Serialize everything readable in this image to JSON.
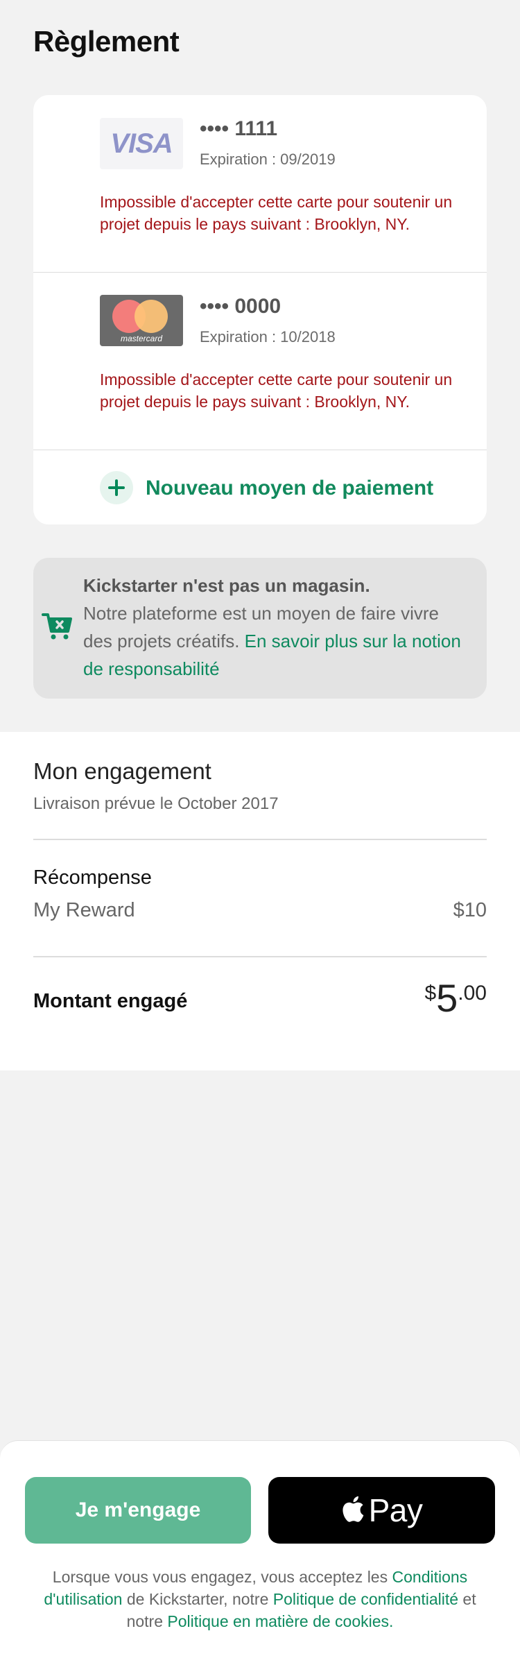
{
  "page": {
    "title": "Règlement"
  },
  "cards": [
    {
      "brand": "visa",
      "logo_text": "VISA",
      "masked_number": "•••• 1111",
      "expiry": "Expiration : 09/2019",
      "error": "Impossible d'accepter cette carte pour soutenir un projet depuis le pays suivant : Brooklyn, NY."
    },
    {
      "brand": "mastercard",
      "logo_text": "mastercard",
      "masked_number": "•••• 0000",
      "expiry": "Expiration : 10/2018",
      "error": "Impossible d'accepter cette carte pour soutenir un projet depuis le pays suivant : Brooklyn, NY."
    }
  ],
  "add_payment": {
    "label": "Nouveau moyen de paiement",
    "icon": "plus-icon"
  },
  "notice": {
    "icon": "cart-icon",
    "heading": "Kickstarter n'est pas un magasin.",
    "body": "Notre plateforme est un moyen de faire vivre des projets créatifs. ",
    "link": "En savoir plus sur la notion de responsabilité"
  },
  "pledge": {
    "title": "Mon engagement",
    "delivery": "Livraison prévue le October 2017",
    "reward_heading": "Récompense",
    "reward_name": "My Reward",
    "reward_price": "$10",
    "pledged_label": "Montant engagé",
    "amount_currency": "$",
    "amount_integer": "5",
    "amount_decimal": ".00"
  },
  "footer": {
    "pledge_button": "Je m'engage",
    "apple_pay_label": "Pay",
    "legal_1": "Lorsque vous vous engagez, vous acceptez les ",
    "legal_link_1": "Conditions d'utilisation",
    "legal_2": " de Kickstarter, notre ",
    "legal_link_2": "Politique de confidentialité",
    "legal_3": " et notre ",
    "legal_link_3": "Politique en matière de cookies."
  },
  "colors": {
    "accent": "#028858",
    "error": "#a4161a",
    "pledge_button": "#5fb894",
    "background": "#f2f2f2"
  }
}
